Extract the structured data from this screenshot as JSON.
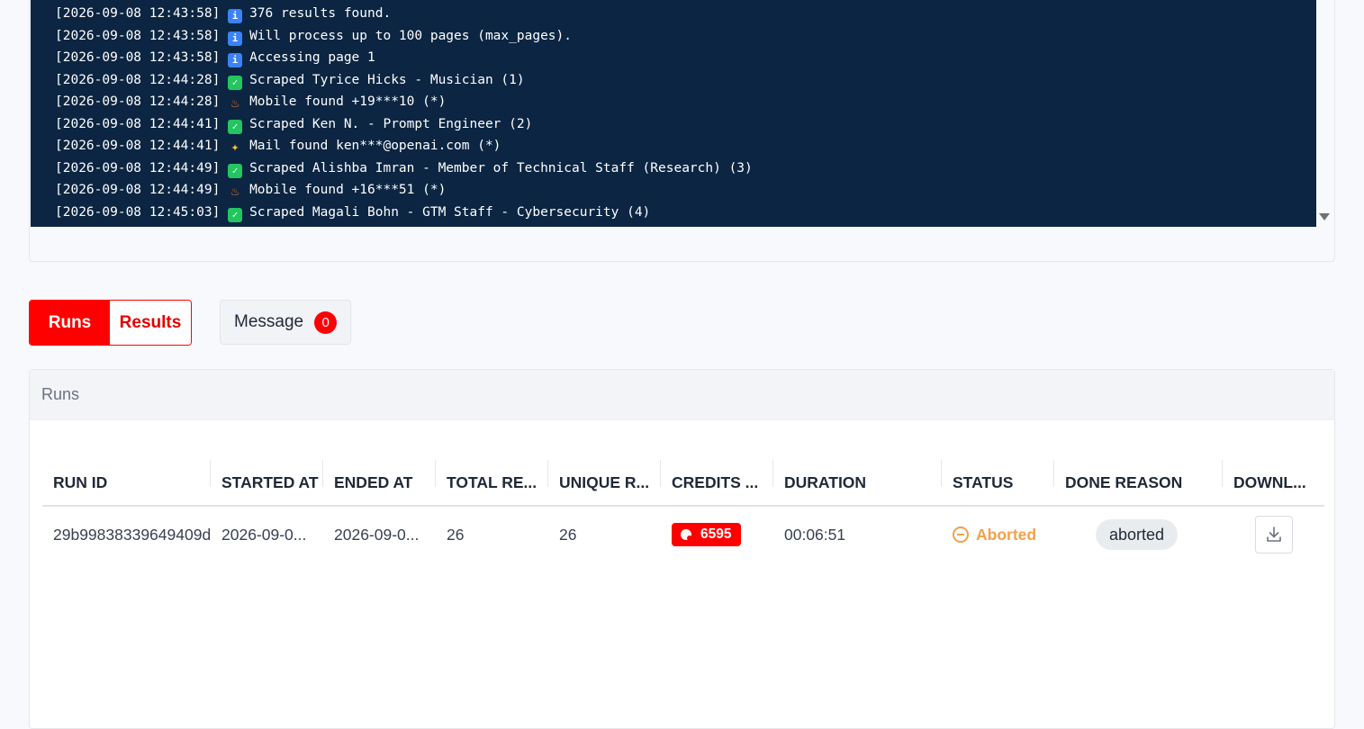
{
  "log": {
    "lines": [
      {
        "time": "[2026-09-08 12:43:58]",
        "icon": "info-icon",
        "text": "376 results found."
      },
      {
        "time": "[2026-09-08 12:43:58]",
        "icon": "info-icon",
        "text": "Will process up to 100 pages (max_pages)."
      },
      {
        "time": "[2026-09-08 12:43:58]",
        "icon": "info-icon",
        "text": "Accessing page 1"
      },
      {
        "time": "[2026-09-08 12:44:28]",
        "icon": "check-icon",
        "text": "Scraped Tyrice Hicks - Musician (1)"
      },
      {
        "time": "[2026-09-08 12:44:28]",
        "icon": "fire-icon",
        "text": "Mobile found +19***10 (*)"
      },
      {
        "time": "[2026-09-08 12:44:41]",
        "icon": "check-icon",
        "text": "Scraped Ken N. - Prompt Engineer (2)"
      },
      {
        "time": "[2026-09-08 12:44:41]",
        "icon": "sparkle-icon",
        "text": "Mail found ken***@openai.com (*)"
      },
      {
        "time": "[2026-09-08 12:44:49]",
        "icon": "check-icon",
        "text": "Scraped Alishba Imran - Member of Technical Staff (Research) (3)"
      },
      {
        "time": "[2026-09-08 12:44:49]",
        "icon": "fire-icon",
        "text": "Mobile found +16***51 (*)"
      },
      {
        "time": "[2026-09-08 12:45:03]",
        "icon": "check-icon",
        "text": "Scraped Magali Bohn - GTM Staff - Cybersecurity (4)"
      }
    ]
  },
  "tabs": {
    "runs_label": "Runs",
    "results_label": "Results",
    "message_label": "Message",
    "message_count": "0"
  },
  "runs_panel": {
    "title": "Runs",
    "columns": [
      "RUN ID",
      "STARTED AT",
      "ENDED AT",
      "TOTAL RE...",
      "UNIQUE R...",
      "CREDITS ...",
      "DURATION",
      "STATUS",
      "DONE REASON",
      "DOWNL..."
    ],
    "rows": [
      {
        "run_id": "29b99838339649409d",
        "started_at": "2026-09-0...",
        "ended_at": "2026-09-0...",
        "total_results": "26",
        "unique_results": "26",
        "credits": "6595",
        "duration": "00:06:51",
        "status": "Aborted",
        "done_reason": "aborted"
      }
    ]
  },
  "colors": {
    "accent": "#ff0000",
    "console_bg": "#0b2542",
    "status_aborted": "#f4a04a"
  }
}
